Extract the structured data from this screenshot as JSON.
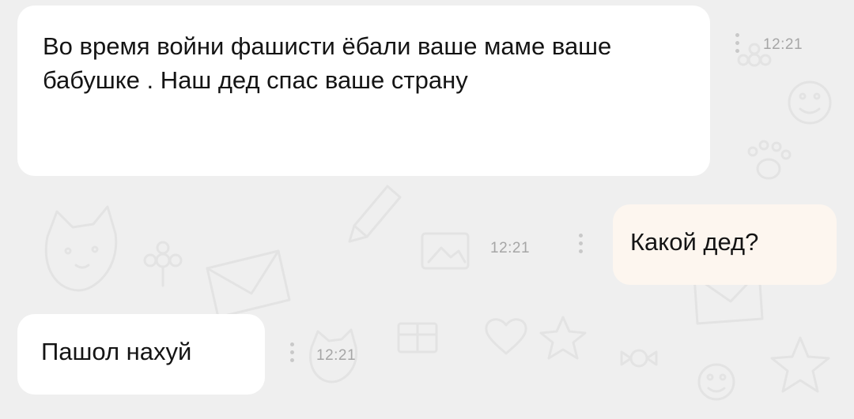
{
  "chat": {
    "messages": [
      {
        "direction": "incoming",
        "text": "Во время войни фашисти ёбали ваше маме ваше бабушке . Наш дед спас ваше страну",
        "time": "12:21"
      },
      {
        "direction": "outgoing",
        "text": "Какой дед?",
        "time": "12:21"
      },
      {
        "direction": "incoming",
        "text": "Пашол нахуй",
        "time": "12:21"
      }
    ],
    "colors": {
      "background": "#efefef",
      "incoming_bubble": "#ffffff",
      "outgoing_bubble": "#fdf6ef",
      "text": "#141414",
      "time": "#a6a6a6",
      "doodle": "#e3e3e3"
    },
    "background_doodle_icons": [
      "cat-face-icon",
      "envelope-icon",
      "pencil-icon",
      "flower-icon",
      "paw-icon",
      "smiley-icon",
      "star-icon",
      "photo-icon",
      "heart-icon",
      "candy-icon",
      "gift-icon"
    ],
    "message_menu_icon": "vertical-dots-icon"
  }
}
